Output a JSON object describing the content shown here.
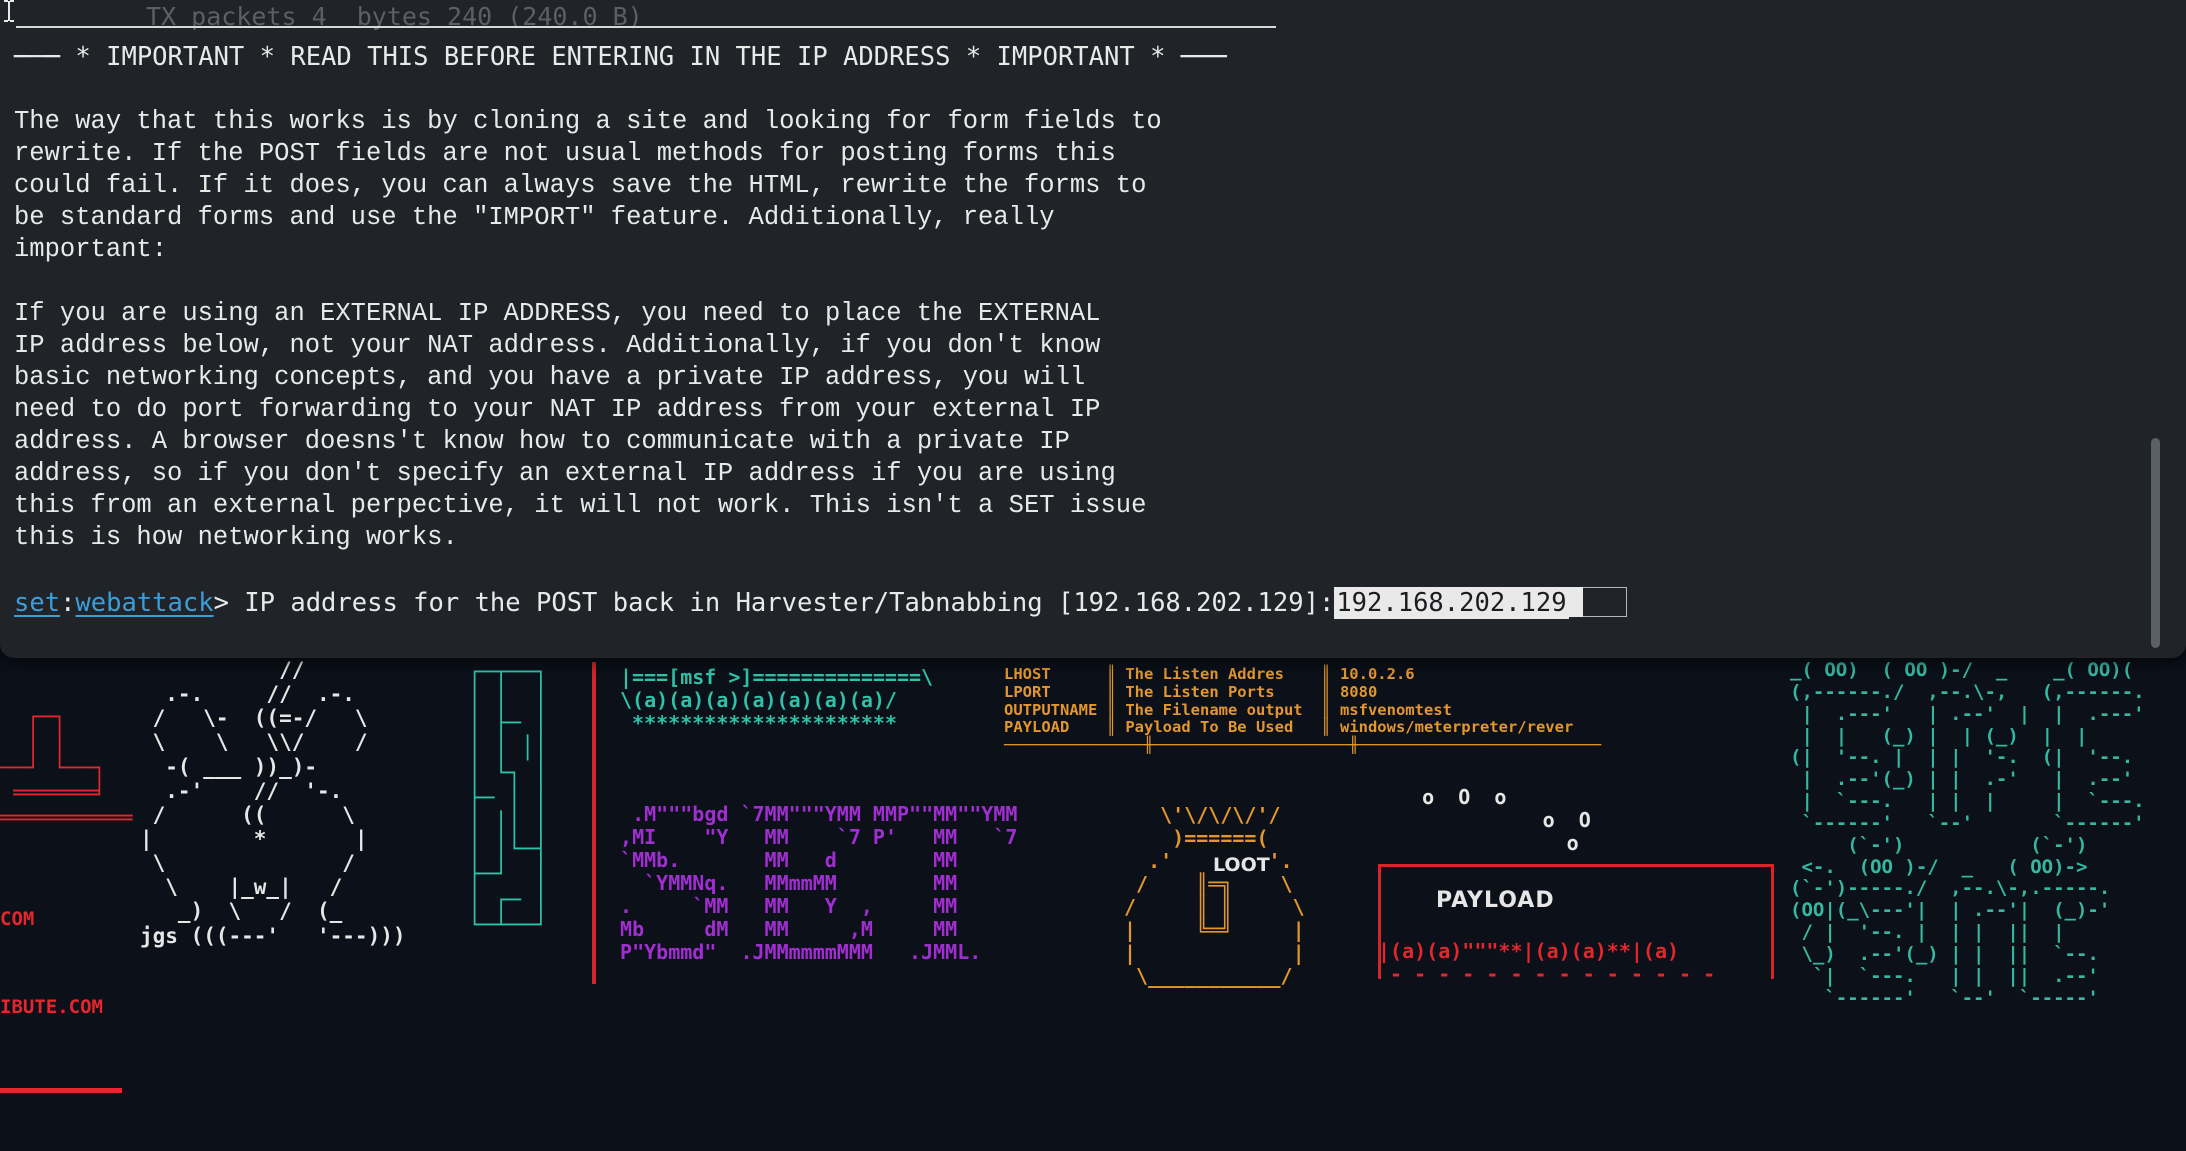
{
  "terminal": {
    "ghost_line": "TX packets 4  bytes 240 (240.0 B)",
    "banner": "─── * IMPORTANT * READ THIS BEFORE ENTERING IN THE IP ADDRESS * IMPORTANT * ───",
    "paragraph1": "The way that this works is by cloning a site and looking for form fields to\nrewrite. If the POST fields are not usual methods for posting forms this\ncould fail. If it does, you can always save the HTML, rewrite the forms to\nbe standard forms and use the \"IMPORT\" feature. Additionally, really\nimportant:",
    "paragraph2": "If you are using an EXTERNAL IP ADDRESS, you need to place the EXTERNAL\nIP address below, not your NAT address. Additionally, if you don't know\nbasic networking concepts, and you have a private IP address, you will\nneed to do port forwarding to your NAT IP address from your external IP\naddress. A browser doesns't know how to communicate with a private IP\naddress, so if you don't specify an external IP address if you are using\nthis from an external perpective, it will not work. This isn't a SET issue\nthis is how networking works.",
    "prompt": {
      "module_prefix": "set",
      "separator": ":",
      "module_name": "webattack",
      "text": "> IP address for the POST back in Harvester/Tabnabbing [192.168.202.129]:",
      "input_value": "192.168.202.129"
    }
  },
  "wallpaper": {
    "left_url_1": "COM",
    "left_url_2": "IBUTE.COM",
    "bear_signature": "jgs",
    "msf_label": "[msf >]",
    "table": {
      "col1": [
        "LHOST",
        "LPORT",
        "OUTPUTNAME",
        "PAYLOAD"
      ],
      "col2": [
        "The Listen Addres",
        "The Listen Ports",
        "The Filename output",
        "Payload To Be Used"
      ],
      "col3": [
        "10.0.2.6",
        "8080",
        "msfvenomtest",
        "windows/meterpreter/rever"
      ]
    },
    "loot_label": "LOOT",
    "payload_label": "PAYLOAD"
  }
}
